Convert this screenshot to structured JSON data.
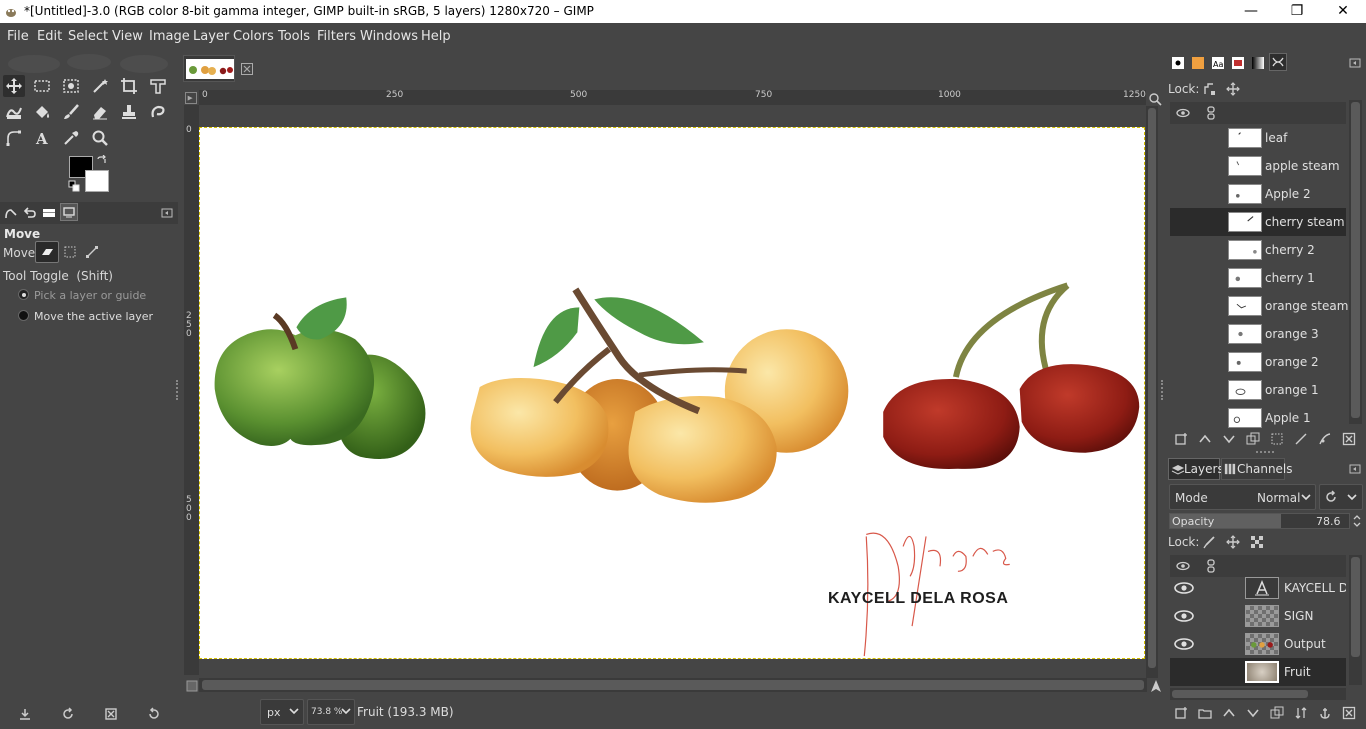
{
  "window": {
    "title": "*[Untitled]-3.0 (RGB color 8-bit gamma integer, GIMP built-in sRGB, 5 layers) 1280x720 – GIMP",
    "minimize": "—",
    "restore": "❐",
    "close": "✕"
  },
  "menu": [
    "File",
    "Edit",
    "Select",
    "View",
    "Image",
    "Layer",
    "Colors",
    "Tools",
    "Filters",
    "Windows",
    "Help"
  ],
  "tool_options": {
    "title": "Move",
    "move_label": "Move:",
    "toggle_label": "Tool Toggle  (Shift)",
    "option1": "Pick a layer or guide",
    "option2": "Move the active layer"
  },
  "rulers": {
    "h": [
      "0",
      "250",
      "500",
      "750",
      "1000",
      "1250"
    ],
    "v": [
      "0",
      "2\n5\n0",
      "5\n0\n0"
    ]
  },
  "canvas": {
    "signature_text": "KAYCELL DELA ROSA",
    "signature_script": "dela rosa"
  },
  "statusbar": {
    "unit": "px",
    "zoom": "73.8 %",
    "info": "Fruit (193.3 MB)"
  },
  "paths_panel": {
    "lock_label": "Lock:",
    "layers": [
      {
        "name": "leaf",
        "selected": false
      },
      {
        "name": "apple steam",
        "selected": false
      },
      {
        "name": "Apple 2",
        "selected": false
      },
      {
        "name": "cherry steam",
        "selected": true
      },
      {
        "name": "cherry 2",
        "selected": false
      },
      {
        "name": "cherry 1",
        "selected": false
      },
      {
        "name": "orange steam",
        "selected": false
      },
      {
        "name": "orange 3",
        "selected": false
      },
      {
        "name": "orange 2",
        "selected": false
      },
      {
        "name": "orange 1",
        "selected": false
      },
      {
        "name": "Apple 1",
        "selected": false
      }
    ]
  },
  "layers_panel": {
    "tab_layers": "Layers",
    "tab_channels": "Channels",
    "mode_label": "Mode",
    "mode_value": "Normal",
    "opacity_label": "Opacity",
    "opacity_value": "78.6",
    "opacity_fraction": 0.786,
    "lock_label": "Lock:",
    "layers": [
      {
        "name": "KAYCELL DE",
        "visible": true,
        "kind": "text"
      },
      {
        "name": "SIGN",
        "visible": true,
        "kind": "checker"
      },
      {
        "name": "Output",
        "visible": true,
        "kind": "checker"
      },
      {
        "name": "Fruit",
        "visible": false,
        "kind": "image"
      }
    ]
  },
  "colors": {
    "bg": "#454545",
    "accent_selected": "#2b2b2b",
    "fg_swatch": "#000000",
    "bg_swatch": "#ffffff"
  }
}
